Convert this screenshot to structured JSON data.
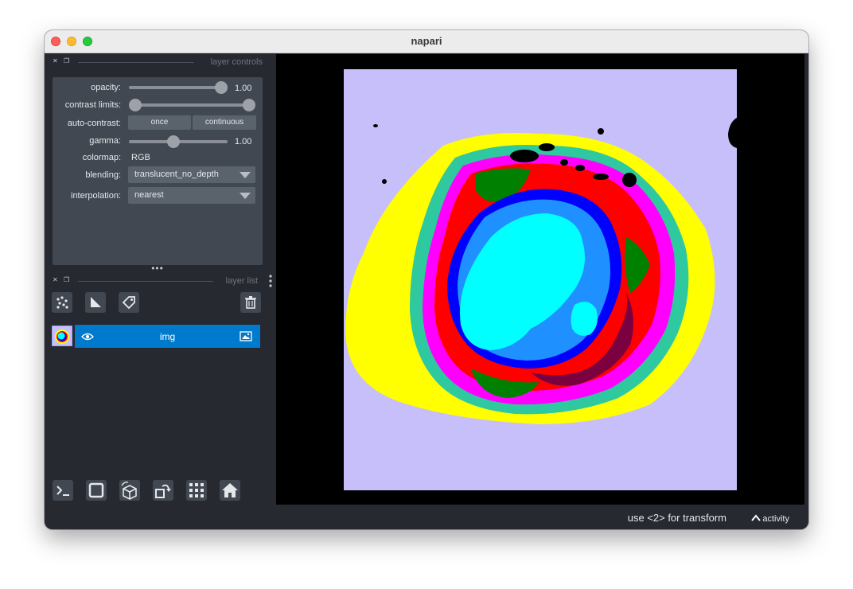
{
  "window": {
    "title": "napari"
  },
  "layer_controls": {
    "header": "layer controls",
    "opacity": {
      "label": "opacity:",
      "value": "1.00"
    },
    "contrast_limits": {
      "label": "contrast limits:"
    },
    "auto_contrast": {
      "label": "auto-contrast:",
      "once": "once",
      "continuous": "continuous"
    },
    "gamma": {
      "label": "gamma:",
      "value": "1.00"
    },
    "colormap": {
      "label": "colormap:",
      "value": "RGB"
    },
    "blending": {
      "label": "blending:",
      "value": "translucent_no_depth"
    },
    "interpolation": {
      "label": "interpolation:",
      "value": "nearest"
    }
  },
  "layer_list": {
    "header": "layer list",
    "layers": [
      {
        "name": "img",
        "visible": true,
        "type": "image"
      }
    ]
  },
  "status": {
    "message": "use <2> for transform",
    "activity": "activity"
  },
  "colors": {
    "bg": "#262930",
    "panel": "#414851",
    "selected": "#007acc",
    "image_background": "#c7bffa"
  },
  "icons": {
    "layer_tools": [
      "points-icon",
      "shapes-icon",
      "labels-icon"
    ],
    "delete": "trash-icon",
    "bottom": [
      "console-icon",
      "ndisplay-square-icon",
      "roll-cube-icon",
      "transpose-icon",
      "grid-icon",
      "home-icon"
    ]
  }
}
